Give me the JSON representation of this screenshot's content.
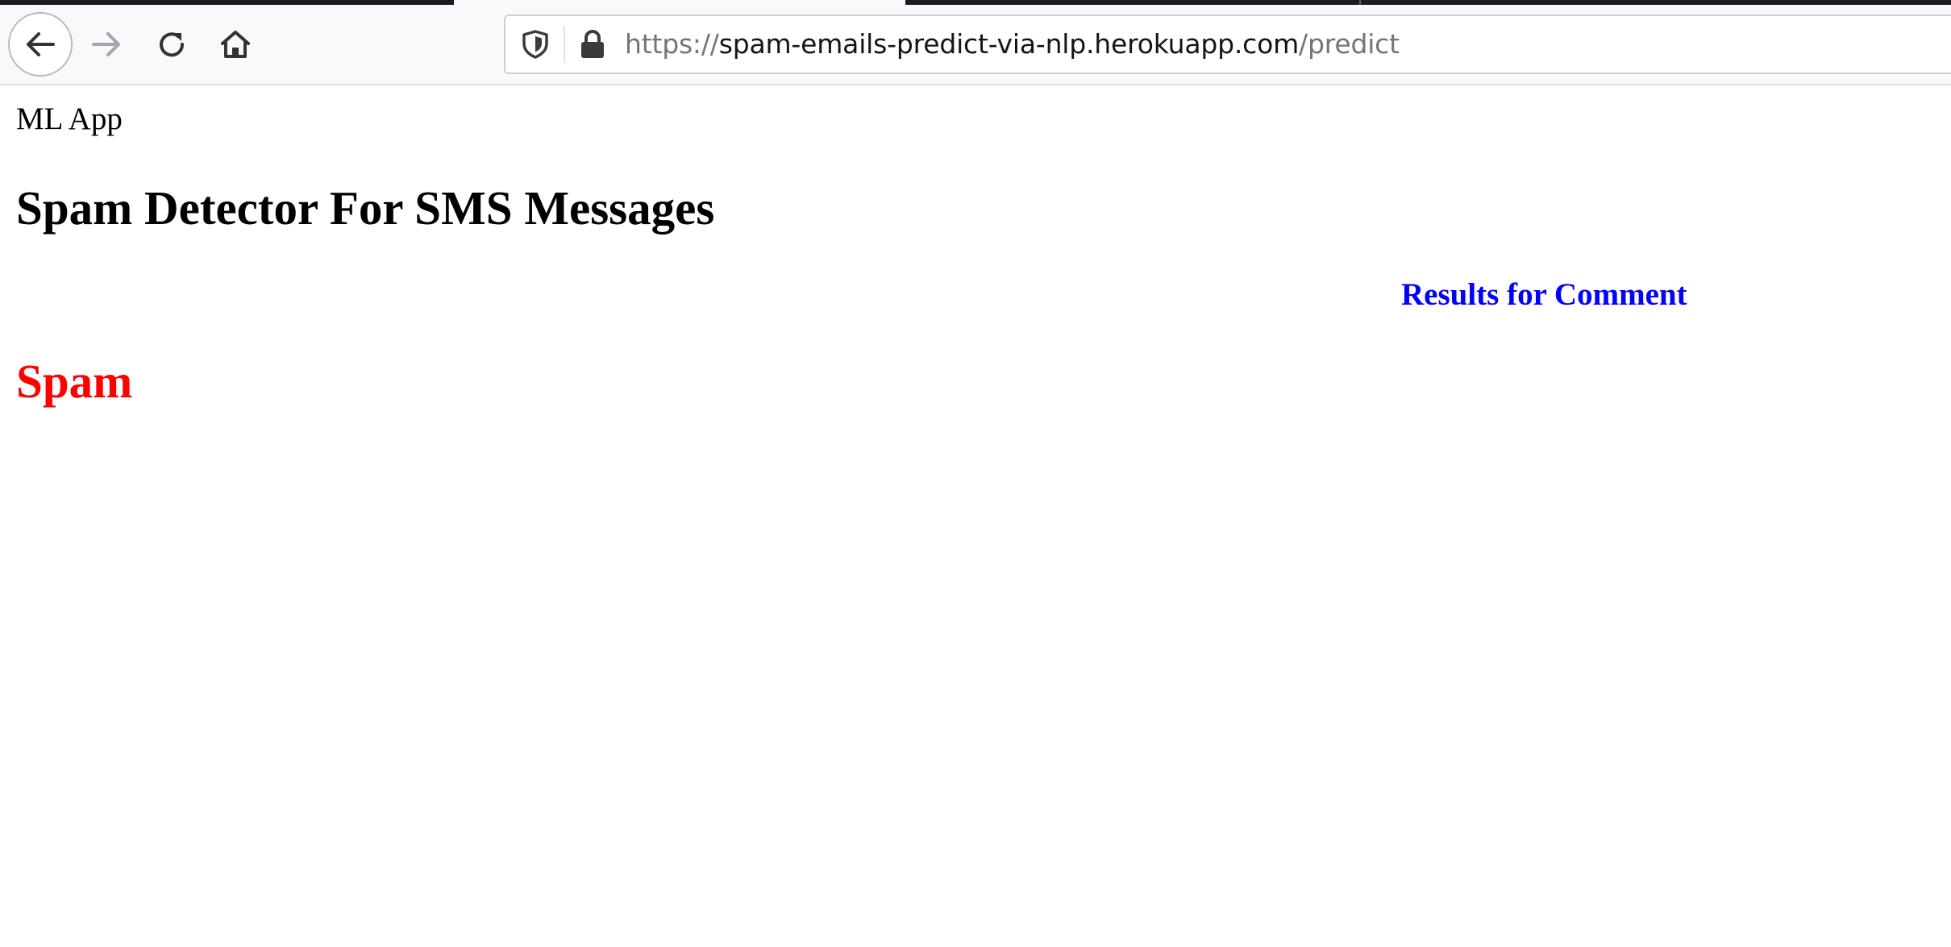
{
  "browser": {
    "url": {
      "scheme": "https://",
      "host": "spam-emails-predict-via-nlp.herokuapp.com",
      "path": "/predict"
    },
    "icons": {
      "back": "back-arrow-icon",
      "forward": "forward-arrow-icon",
      "reload": "reload-icon",
      "home": "home-icon",
      "tracking_protection": "shield-icon",
      "security": "lock-icon"
    }
  },
  "page": {
    "app_name": "ML App",
    "title": "Spam Detector For SMS Messages",
    "results_heading": "Results for Comment",
    "prediction": "Spam"
  },
  "colors": {
    "results_heading": "#0000ff",
    "prediction": "#ff0000"
  }
}
